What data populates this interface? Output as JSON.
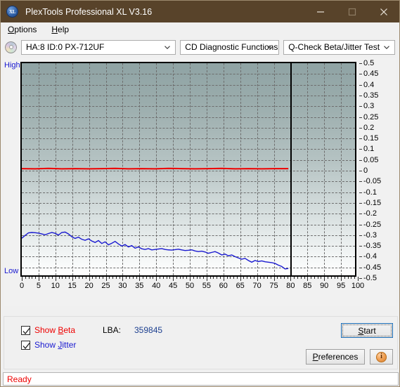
{
  "window": {
    "title": "PlexTools Professional XL V3.16",
    "icon": "xl-logo-icon",
    "minimize": "minimize-icon",
    "maximize": "maximize-icon",
    "close": "close-icon"
  },
  "menu": {
    "items": [
      {
        "label": "Options",
        "accel": "O"
      },
      {
        "label": "Help",
        "accel": "H"
      }
    ]
  },
  "toolbar": {
    "disc_icon": "cd-disc-icon",
    "drive_select": {
      "value": "HA:8 ID:0  PX-712UF",
      "options": [
        "HA:8 ID:0  PX-712UF"
      ]
    },
    "function_select": {
      "value": "CD Diagnostic Functions",
      "options": [
        "CD Diagnostic Functions"
      ]
    },
    "test_select": {
      "value": "Q-Check Beta/Jitter Test",
      "options": [
        "Q-Check Beta/Jitter Test"
      ]
    }
  },
  "chart_data": {
    "type": "line",
    "title": "Q-Check Beta/Jitter Test",
    "xlabel": "",
    "ylabel": "",
    "xlim": [
      0,
      100
    ],
    "ylim": [
      -0.5,
      0.5
    ],
    "grid": true,
    "legend_position": "bottom-left",
    "x_ticks": [
      0,
      5,
      10,
      15,
      20,
      25,
      30,
      35,
      40,
      45,
      50,
      55,
      60,
      65,
      70,
      75,
      80,
      85,
      90,
      95,
      100
    ],
    "y_ticks": [
      0.5,
      0.45,
      0.4,
      0.35,
      0.3,
      0.25,
      0.2,
      0.15,
      0.1,
      0.05,
      0,
      -0.05,
      -0.1,
      -0.15,
      -0.2,
      -0.25,
      -0.3,
      -0.35,
      -0.4,
      -0.45,
      -0.5
    ],
    "axis_labels": {
      "top_left": "High",
      "bottom_left": "Low"
    },
    "annotations": [
      {
        "type": "vline",
        "x": 80,
        "color": "#000000",
        "label": "data-end-marker"
      }
    ],
    "series": [
      {
        "name": "Show Beta",
        "color": "#ee0000",
        "x": [
          0,
          4,
          8,
          12,
          16,
          20,
          24,
          28,
          32,
          36,
          40,
          44,
          48,
          52,
          56,
          60,
          64,
          68,
          72,
          76,
          80
        ],
        "values": [
          0.003,
          0.002,
          0.004,
          0.002,
          0.003,
          0.002,
          0.003,
          0.004,
          0.002,
          0.003,
          0.002,
          0.004,
          0.003,
          0.002,
          0.003,
          0.004,
          0.002,
          0.003,
          0.002,
          0.003,
          0.003
        ]
      },
      {
        "name": "Show Jitter",
        "color": "#1a1ad0",
        "x": [
          0,
          1,
          2,
          3,
          4,
          5,
          6,
          7,
          8,
          9,
          10,
          11,
          12,
          13,
          14,
          15,
          16,
          17,
          18,
          19,
          20,
          21,
          22,
          23,
          24,
          25,
          26,
          27,
          28,
          29,
          30,
          31,
          32,
          33,
          34,
          35,
          36,
          37,
          38,
          39,
          40,
          41,
          42,
          43,
          44,
          45,
          46,
          47,
          48,
          49,
          50,
          51,
          52,
          53,
          54,
          55,
          56,
          57,
          58,
          59,
          60,
          61,
          62,
          63,
          64,
          65,
          66,
          67,
          68,
          69,
          70,
          71,
          72,
          73,
          74,
          75,
          76,
          77,
          78,
          79,
          80
        ],
        "values": [
          -0.325,
          -0.312,
          -0.3,
          -0.298,
          -0.299,
          -0.301,
          -0.305,
          -0.309,
          -0.303,
          -0.298,
          -0.302,
          -0.31,
          -0.298,
          -0.296,
          -0.305,
          -0.318,
          -0.326,
          -0.32,
          -0.33,
          -0.335,
          -0.328,
          -0.338,
          -0.345,
          -0.336,
          -0.35,
          -0.342,
          -0.356,
          -0.349,
          -0.34,
          -0.352,
          -0.362,
          -0.355,
          -0.366,
          -0.36,
          -0.372,
          -0.366,
          -0.375,
          -0.378,
          -0.374,
          -0.38,
          -0.378,
          -0.376,
          -0.374,
          -0.378,
          -0.38,
          -0.381,
          -0.379,
          -0.377,
          -0.38,
          -0.383,
          -0.382,
          -0.38,
          -0.385,
          -0.388,
          -0.386,
          -0.39,
          -0.396,
          -0.392,
          -0.388,
          -0.395,
          -0.404,
          -0.4,
          -0.408,
          -0.404,
          -0.412,
          -0.418,
          -0.424,
          -0.42,
          -0.43,
          -0.438,
          -0.43,
          -0.435,
          -0.432,
          -0.436,
          -0.438,
          -0.44,
          -0.444,
          -0.452,
          -0.458,
          -0.47,
          -0.468
        ]
      }
    ]
  },
  "controls": {
    "show_beta": {
      "label_pre": "Show ",
      "label_accel": "B",
      "label_post": "eta",
      "checked": true
    },
    "show_jitter": {
      "label_pre": "Show ",
      "label_accel": "J",
      "label_post": "itter",
      "checked": true
    },
    "lba_label": "LBA:",
    "lba_value": "359845",
    "start_button": {
      "pre": "",
      "accel": "S",
      "post": "tart"
    },
    "preferences_button": {
      "pre": "",
      "accel": "P",
      "post": "references"
    },
    "info_button": {
      "icon": "info-icon",
      "glyph": "i"
    }
  },
  "status": {
    "text": "Ready"
  }
}
